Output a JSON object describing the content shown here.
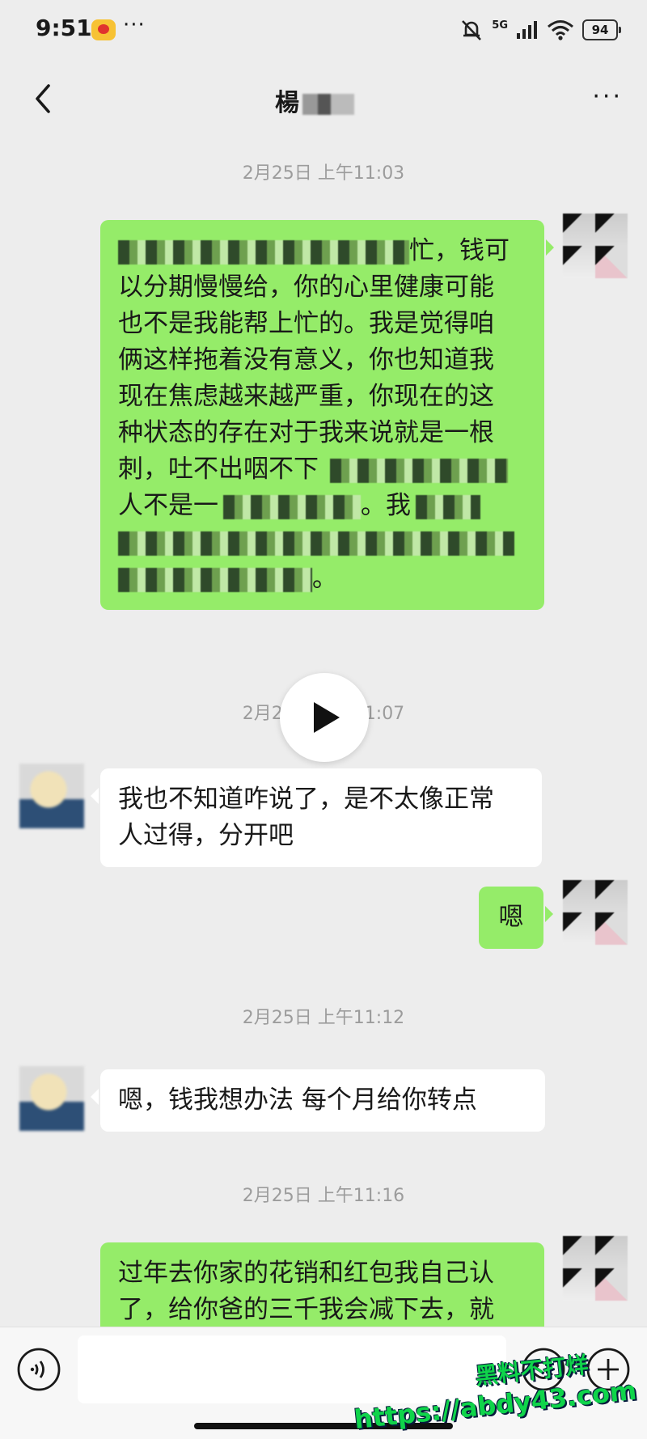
{
  "status_bar": {
    "time": "9:51",
    "more": "···",
    "network": "5G",
    "battery": "94"
  },
  "header": {
    "contact_name": "楊",
    "more": "···"
  },
  "messages": [
    {
      "type": "timestamp",
      "text": "2月25日 上午11:03"
    },
    {
      "type": "sent",
      "lines": [
        "忙，钱可",
        "以分期慢慢给，你的心里健康可能",
        "也不是我能帮上忙的。我是觉得咱",
        "俩这样拖着没有意义，你也知道我",
        "现在焦虑越来越严重，你现在的这",
        "种状态的存在对于我来说就是一根",
        "刺，吐不出咽不下",
        "人不是一",
        "。我",
        "",
        "。"
      ]
    },
    {
      "type": "timestamp",
      "text": "2月25日 上午11:07"
    },
    {
      "type": "received",
      "lines": [
        "我也不知道咋说了，是不太像正常",
        "人过得，分开吧"
      ]
    },
    {
      "type": "sent",
      "lines": [
        "嗯"
      ]
    },
    {
      "type": "timestamp",
      "text": "2月25日 上午11:12"
    },
    {
      "type": "received",
      "lines": [
        "嗯，钱我想办法 每个月给你转点"
      ]
    },
    {
      "type": "timestamp",
      "text": "2月25日 上午11:16"
    },
    {
      "type": "sent",
      "lines": [
        "过年去你家的花销和红包我自己认",
        "了，给你爸的三千我会减下去，就"
      ]
    }
  ],
  "watermark": {
    "line1": "黑料不打烊",
    "line2": "https://abdy43.com"
  },
  "colors": {
    "sent_bubble": "#95ec69",
    "received_bubble": "#ffffff",
    "background": "#ededed"
  },
  "icons": [
    "back-arrow-icon",
    "more-dots-icon",
    "play-icon",
    "voice-icon",
    "emoji-icon",
    "plus-icon"
  ]
}
